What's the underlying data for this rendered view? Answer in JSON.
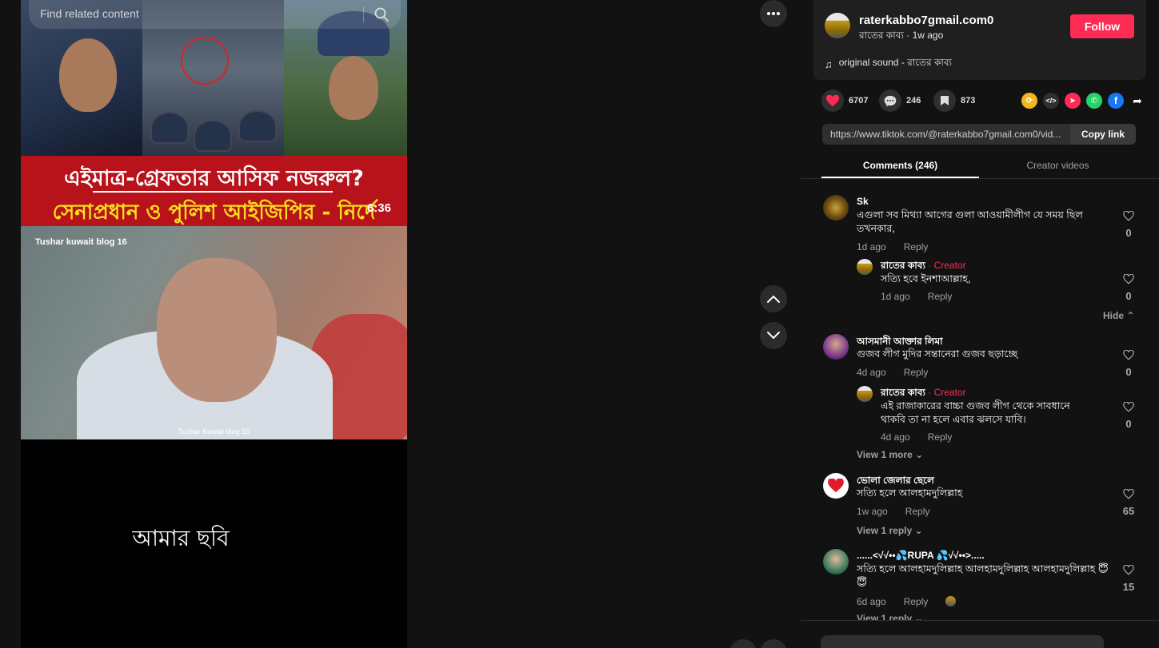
{
  "search": {
    "placeholder": "Find related content"
  },
  "video": {
    "banner_line1": "এইমাত্র-গ্রেফতার আসিফ নজরুল?",
    "banner_line2": "সেনাপ্রধান ও পুলিশ আইজিপির - নির্দে",
    "duration": "6:36",
    "mid_title": "Tushar kuwait blog 16",
    "mid_footer": "Tushar Kuwait blog 16",
    "caption": "আমার ছবি"
  },
  "author": {
    "username": "raterkabbo7gmail.com0",
    "display_name": "রাতের কাব্য",
    "time": "1w ago",
    "follow_label": "Follow",
    "sound": "original sound - রাতের কাব্য"
  },
  "stats": {
    "likes": "6707",
    "comments": "246",
    "saves": "873"
  },
  "link": {
    "url": "https://www.tiktok.com/@raterkabbo7gmail.com0/vid...",
    "copy_label": "Copy link"
  },
  "tabs": {
    "comments": "Comments (246)",
    "creator": "Creator videos"
  },
  "reply_label": "Reply",
  "comments": [
    {
      "name": "Sk",
      "text": "এগুলা সব মিথ্যা আগের গুলা আওয়ামীলীগ যে সময় ছিল তখনকার,",
      "time": "1d ago",
      "likes": "0",
      "reply": {
        "name": "রাতের কাব্য",
        "tag": "Creator",
        "text": "সত্যি হবে ইনশাআল্লাহ,",
        "time": "1d ago",
        "likes": "0"
      },
      "footer": "Hide"
    },
    {
      "name": "আসমানী আক্তার লিমা",
      "text": "গুজব লীগ মুদির সন্তানেরা গুজব ছড়াচ্ছে",
      "time": "4d ago",
      "likes": "0",
      "reply": {
        "name": "রাতের কাব্য",
        "tag": "Creator",
        "text": "এই রাজাকারের বাচ্চা গুজব লীগ থেকে সাবধানে থাকবি তা না হলে এবার ঝলসে যাবি।",
        "time": "4d ago",
        "likes": "0"
      },
      "footer": "View 1 more"
    },
    {
      "name": "ভোলা জেলার ছেলে",
      "text": "সত্যি হলে আলহামদুলিল্লাহ",
      "time": "1w ago",
      "likes": "65",
      "footer": "View 1 reply"
    },
    {
      "name": "......<√√••💦RUPA 💦√√••>.....",
      "text": "সত্যি হলে আলহামদুলিল্লাহ আলহামদুলিল্লাহ আলহামদুলিল্লাহ 😇😇",
      "time": "6d ago",
      "likes": "15",
      "footer": "View 1 reply"
    }
  ],
  "colors": {
    "accent": "#fe2c55",
    "like": "#fe2c55"
  }
}
